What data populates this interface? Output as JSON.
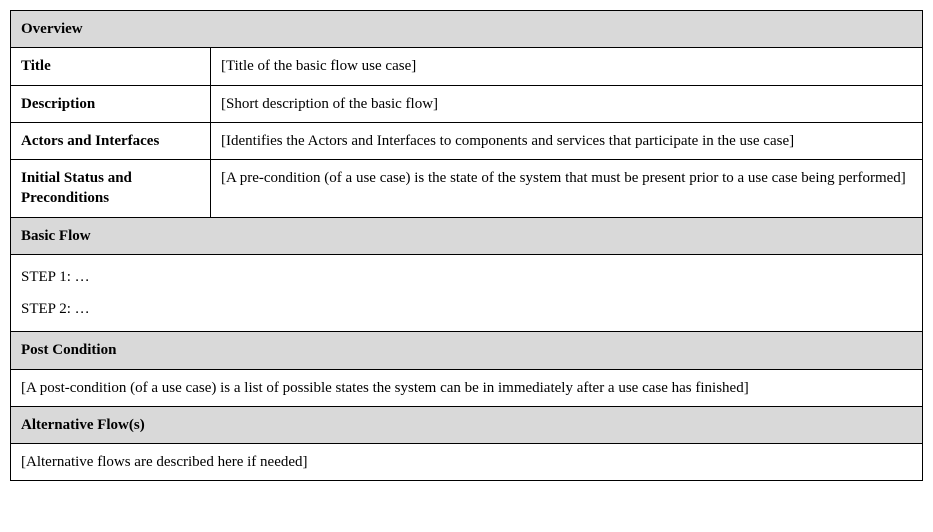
{
  "overview": {
    "header": "Overview",
    "title_label": "Title",
    "title_value": "[Title of the basic flow use case]",
    "description_label": "Description",
    "description_value": "[Short description of the basic flow]",
    "actors_label": "Actors and Interfaces",
    "actors_value": "[Identifies the Actors and Interfaces to components and services that participate in the use case]",
    "preconditions_label": "Initial Status and Preconditions",
    "preconditions_value": "[A pre-condition (of a use case) is the state of the system that must be present prior to a use case being performed]"
  },
  "basic_flow": {
    "header": "Basic Flow",
    "steps": [
      "STEP 1: …",
      "STEP 2: …"
    ]
  },
  "post_condition": {
    "header": "Post Condition",
    "text": "[A post-condition (of a use case) is a list of possible states the system can be in immediately after a use case has finished]"
  },
  "alternative_flow": {
    "header": "Alternative Flow(s)",
    "text": "[Alternative flows are described here if needed]"
  }
}
